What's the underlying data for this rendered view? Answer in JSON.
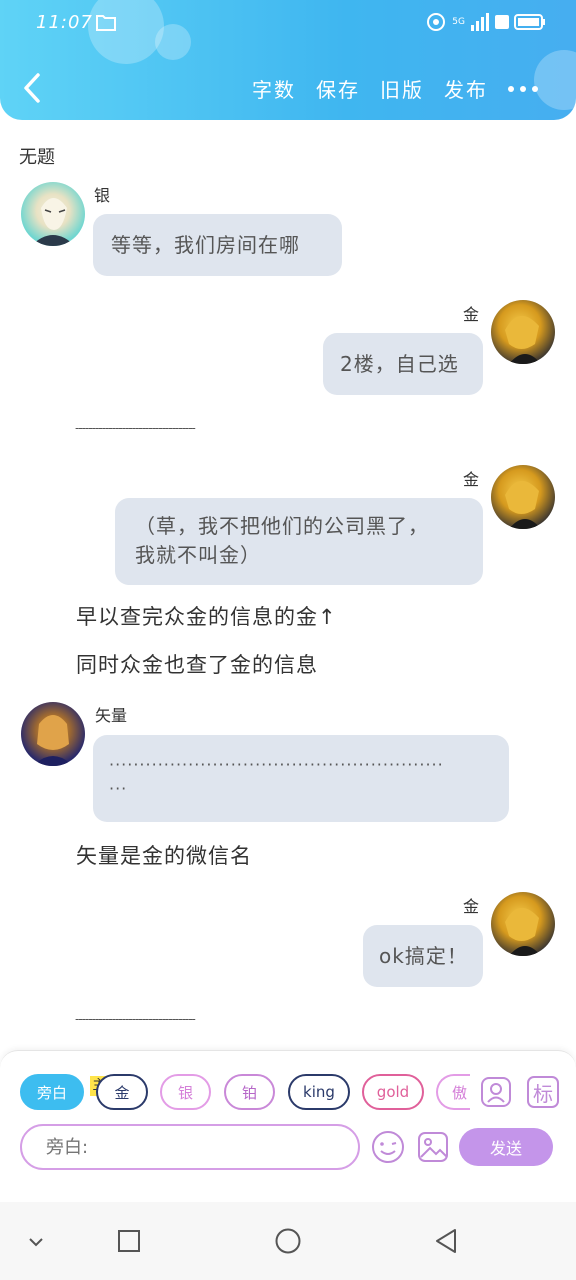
{
  "status": {
    "time": "11:07",
    "network": "5G"
  },
  "nav": {
    "actions": [
      "字数",
      "保存",
      "旧版",
      "发布"
    ]
  },
  "document": {
    "title": "无题"
  },
  "messages": {
    "m1": {
      "speaker": "银",
      "text": "等等，我们房间在哪"
    },
    "m2": {
      "speaker": "金",
      "text": "2楼，自己选"
    },
    "divider": "------------------------------------",
    "m3": {
      "speaker": "金",
      "line1": "（草，我不把他们的公司黑了，",
      "line2": "我就不叫金）"
    },
    "narration1": "早以查完众金的信息的金↑",
    "narration2": "同时众金也查了金的信息",
    "m4": {
      "speaker": "矢量",
      "line1": "·······················································",
      "line2": "···"
    },
    "narration3": "矢量是金的微信名",
    "m5": {
      "speaker": "金",
      "text": "ok搞定！"
    }
  },
  "panel": {
    "chips": [
      "旁白",
      "金",
      "银",
      "铂",
      "king",
      "gold",
      "傲"
    ],
    "main_tag": "主",
    "mark_label": "标",
    "input_placeholder": "旁白:",
    "send_label": "发送"
  },
  "colors": {
    "header_start": "#5fd3f6",
    "header_end": "#46aef0",
    "bubble": "#dfe5ee",
    "send": "#c495ea",
    "chip_active": "#3dbdf0"
  }
}
